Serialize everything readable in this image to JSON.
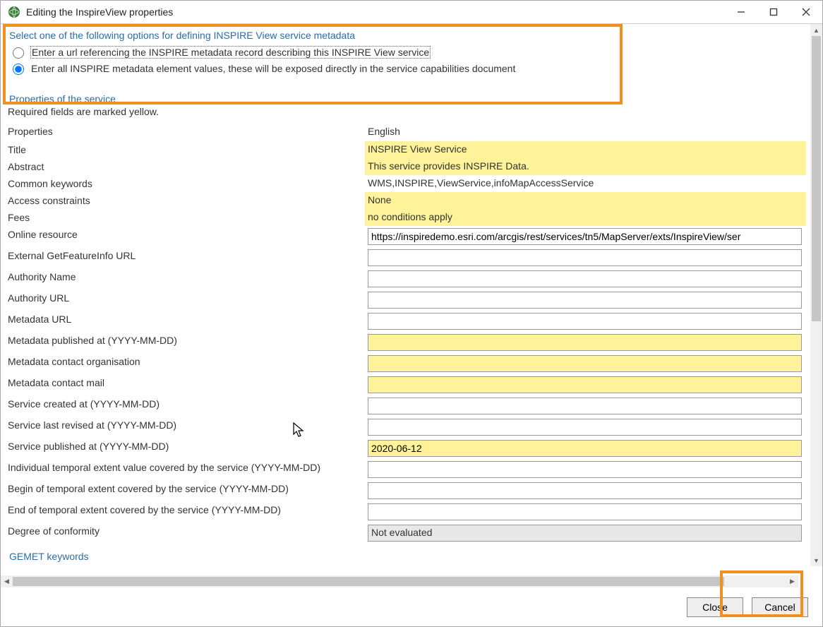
{
  "window": {
    "title": "Editing the InspireView properties"
  },
  "radio": {
    "heading": "Select one of the following options for defining INSPIRE View service metadata",
    "opt_url": "Enter a url referencing the INSPIRE metadata record describing this INSPIRE View service",
    "opt_values": "Enter all INSPIRE metadata element values, these will be exposed directly in the service capabilities document"
  },
  "section": {
    "properties_header": "Properties of the service",
    "required_note": "Required fields are marked yellow.",
    "gemet_header": "GEMET keywords"
  },
  "headers": {
    "properties": "Properties",
    "english": "English"
  },
  "rows": {
    "title_label": "Title",
    "title_value": "INSPIRE View Service",
    "abstract_label": "Abstract",
    "abstract_value": "This service provides INSPIRE Data.",
    "keywords_label": "Common keywords",
    "keywords_value": "WMS,INSPIRE,ViewService,infoMapAccessService",
    "access_label": "Access constraints",
    "access_value": "None",
    "fees_label": "Fees",
    "fees_value": "no conditions apply",
    "online_label": "Online resource",
    "online_value": "https://inspiredemo.esri.com/arcgis/rest/services/tn5/MapServer/exts/InspireView/ser",
    "extgfi_label": "External GetFeatureInfo URL",
    "extgfi_value": "",
    "authname_label": "Authority Name",
    "authname_value": "",
    "authurl_label": "Authority URL",
    "authurl_value": "",
    "metaurl_label": "Metadata URL",
    "metaurl_value": "",
    "metapub_label": "Metadata published at (YYYY-MM-DD)",
    "metapub_value": "",
    "metaorg_label": "Metadata contact organisation",
    "metaorg_value": "",
    "metamail_label": "Metadata contact mail",
    "metamail_value": "",
    "svccreated_label": "Service created at (YYYY-MM-DD)",
    "svccreated_value": "",
    "svcrevised_label": "Service last revised at (YYYY-MM-DD)",
    "svcrevised_value": "",
    "svcpub_label": "Service published at (YYYY-MM-DD)",
    "svcpub_value": "2020-06-12",
    "indtemp_label": "Individual temporal extent value covered by the service (YYYY-MM-DD)",
    "indtemp_value": "",
    "begintemp_label": "Begin of temporal extent covered by the service (YYYY-MM-DD)",
    "begintemp_value": "",
    "endtemp_label": "End of temporal extent covered by the service (YYYY-MM-DD)",
    "endtemp_value": "",
    "conform_label": "Degree of conformity",
    "conform_value": "Not evaluated"
  },
  "buttons": {
    "close": "Close",
    "cancel": "Cancel"
  }
}
